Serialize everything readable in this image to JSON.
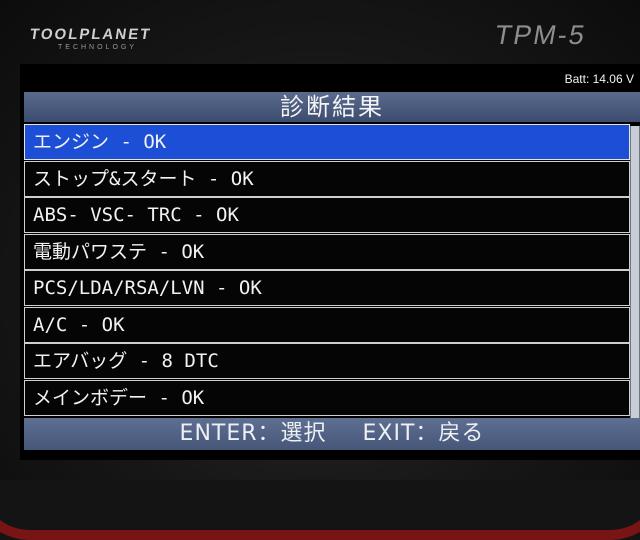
{
  "device": {
    "brand": "TOOLPLANET",
    "brand_sub": "TECHNOLOGY",
    "model": "TPM-5"
  },
  "screen": {
    "battery": "Batt: 14.06 V",
    "title": "診断結果",
    "items": [
      {
        "label": "エンジン - OK",
        "selected": true
      },
      {
        "label": "ストップ&スタート - OK",
        "selected": false
      },
      {
        "label": "ABS- VSC- TRC - OK",
        "selected": false
      },
      {
        "label": "電動パワステ - OK",
        "selected": false
      },
      {
        "label": "PCS/LDA/RSA/LVN - OK",
        "selected": false
      },
      {
        "label": "A/C - OK",
        "selected": false
      },
      {
        "label": "エアバッグ - 8 DTC",
        "selected": false
      },
      {
        "label": "メインボデー - OK",
        "selected": false
      }
    ],
    "footer": {
      "enter": "ENTER：選択",
      "exit": "EXIT：戻る"
    }
  },
  "colors": {
    "selection": "#1c4fd6",
    "titlebar": "#4c5d80",
    "rim": "#8a1414"
  }
}
